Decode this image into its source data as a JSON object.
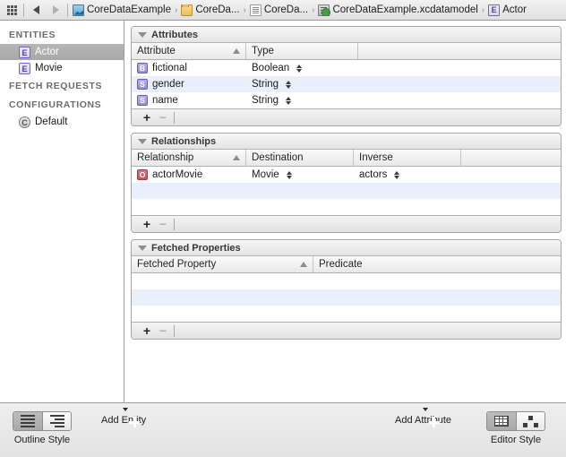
{
  "jumpbar": {
    "grid_icon": "grid-icon",
    "back_icon": "back-arrow-icon",
    "forward_icon": "forward-arrow-icon",
    "crumbs": [
      {
        "label": "CoreDataExample",
        "icon": "xcode-project-icon"
      },
      {
        "label": "CoreDa...",
        "icon": "folder-icon"
      },
      {
        "label": "CoreDa...",
        "icon": "document-icon"
      },
      {
        "label": "CoreDataExample.xcdatamodel",
        "icon": "datamodel-icon"
      },
      {
        "label": "Actor",
        "icon": "entity-icon"
      }
    ],
    "separator": "›"
  },
  "sidebar": {
    "groups": [
      {
        "title": "ENTITIES",
        "items": [
          {
            "label": "Actor",
            "badge": "E",
            "badge_type": "entity",
            "selected": true
          },
          {
            "label": "Movie",
            "badge": "E",
            "badge_type": "entity",
            "selected": false
          }
        ]
      },
      {
        "title": "FETCH REQUESTS",
        "items": []
      },
      {
        "title": "CONFIGURATIONS",
        "items": [
          {
            "label": "Default",
            "badge": "C",
            "badge_type": "configuration",
            "selected": false
          }
        ]
      }
    ]
  },
  "panels": [
    {
      "title": "Attributes",
      "columns": [
        "Attribute",
        "Type",
        ""
      ],
      "sorted_column": 0,
      "rows": [
        {
          "badge": "B",
          "name": "fictional",
          "value": "Boolean",
          "stepper": true
        },
        {
          "badge": "S",
          "name": "gender",
          "value": "String",
          "stepper": true
        },
        {
          "badge": "S",
          "name": "name",
          "value": "String",
          "stepper": true
        }
      ],
      "empty_rows": 0,
      "add_label": "+",
      "remove_label": "−"
    },
    {
      "title": "Relationships",
      "columns": [
        "Relationship",
        "Destination",
        "Inverse",
        ""
      ],
      "sorted_column": 0,
      "rows": [
        {
          "badge": "O",
          "name": "actorMovie",
          "value": "Movie",
          "value2": "actors",
          "stepper": true
        }
      ],
      "empty_rows": 2,
      "add_label": "+",
      "remove_label": "−"
    },
    {
      "title": "Fetched Properties",
      "columns": [
        "Fetched Property",
        "Predicate"
      ],
      "sorted_column": 0,
      "rows": [],
      "empty_rows": 3,
      "add_label": "+",
      "remove_label": "−"
    }
  ],
  "bottombar": {
    "outline_style": {
      "label": "Outline Style",
      "icon_a": "flat-list-icon",
      "icon_b": "outline-list-icon",
      "selected": 0
    },
    "add_entity": {
      "label": "Add Entity",
      "icon": "add-circle-icon"
    },
    "add_attribute": {
      "label": "Add Attribute",
      "icon": "add-circle-icon"
    },
    "editor_style": {
      "label": "Editor Style",
      "icon_a": "table-view-icon",
      "icon_b": "graph-view-icon",
      "selected": 0
    }
  },
  "colors": {
    "selection": "#b6b6b6",
    "alt_row": "#eaf0fb",
    "attribute_badge": "#9a8cd8",
    "relationship_badge": "#c4515f",
    "entity_badge": "#6f64c8"
  }
}
